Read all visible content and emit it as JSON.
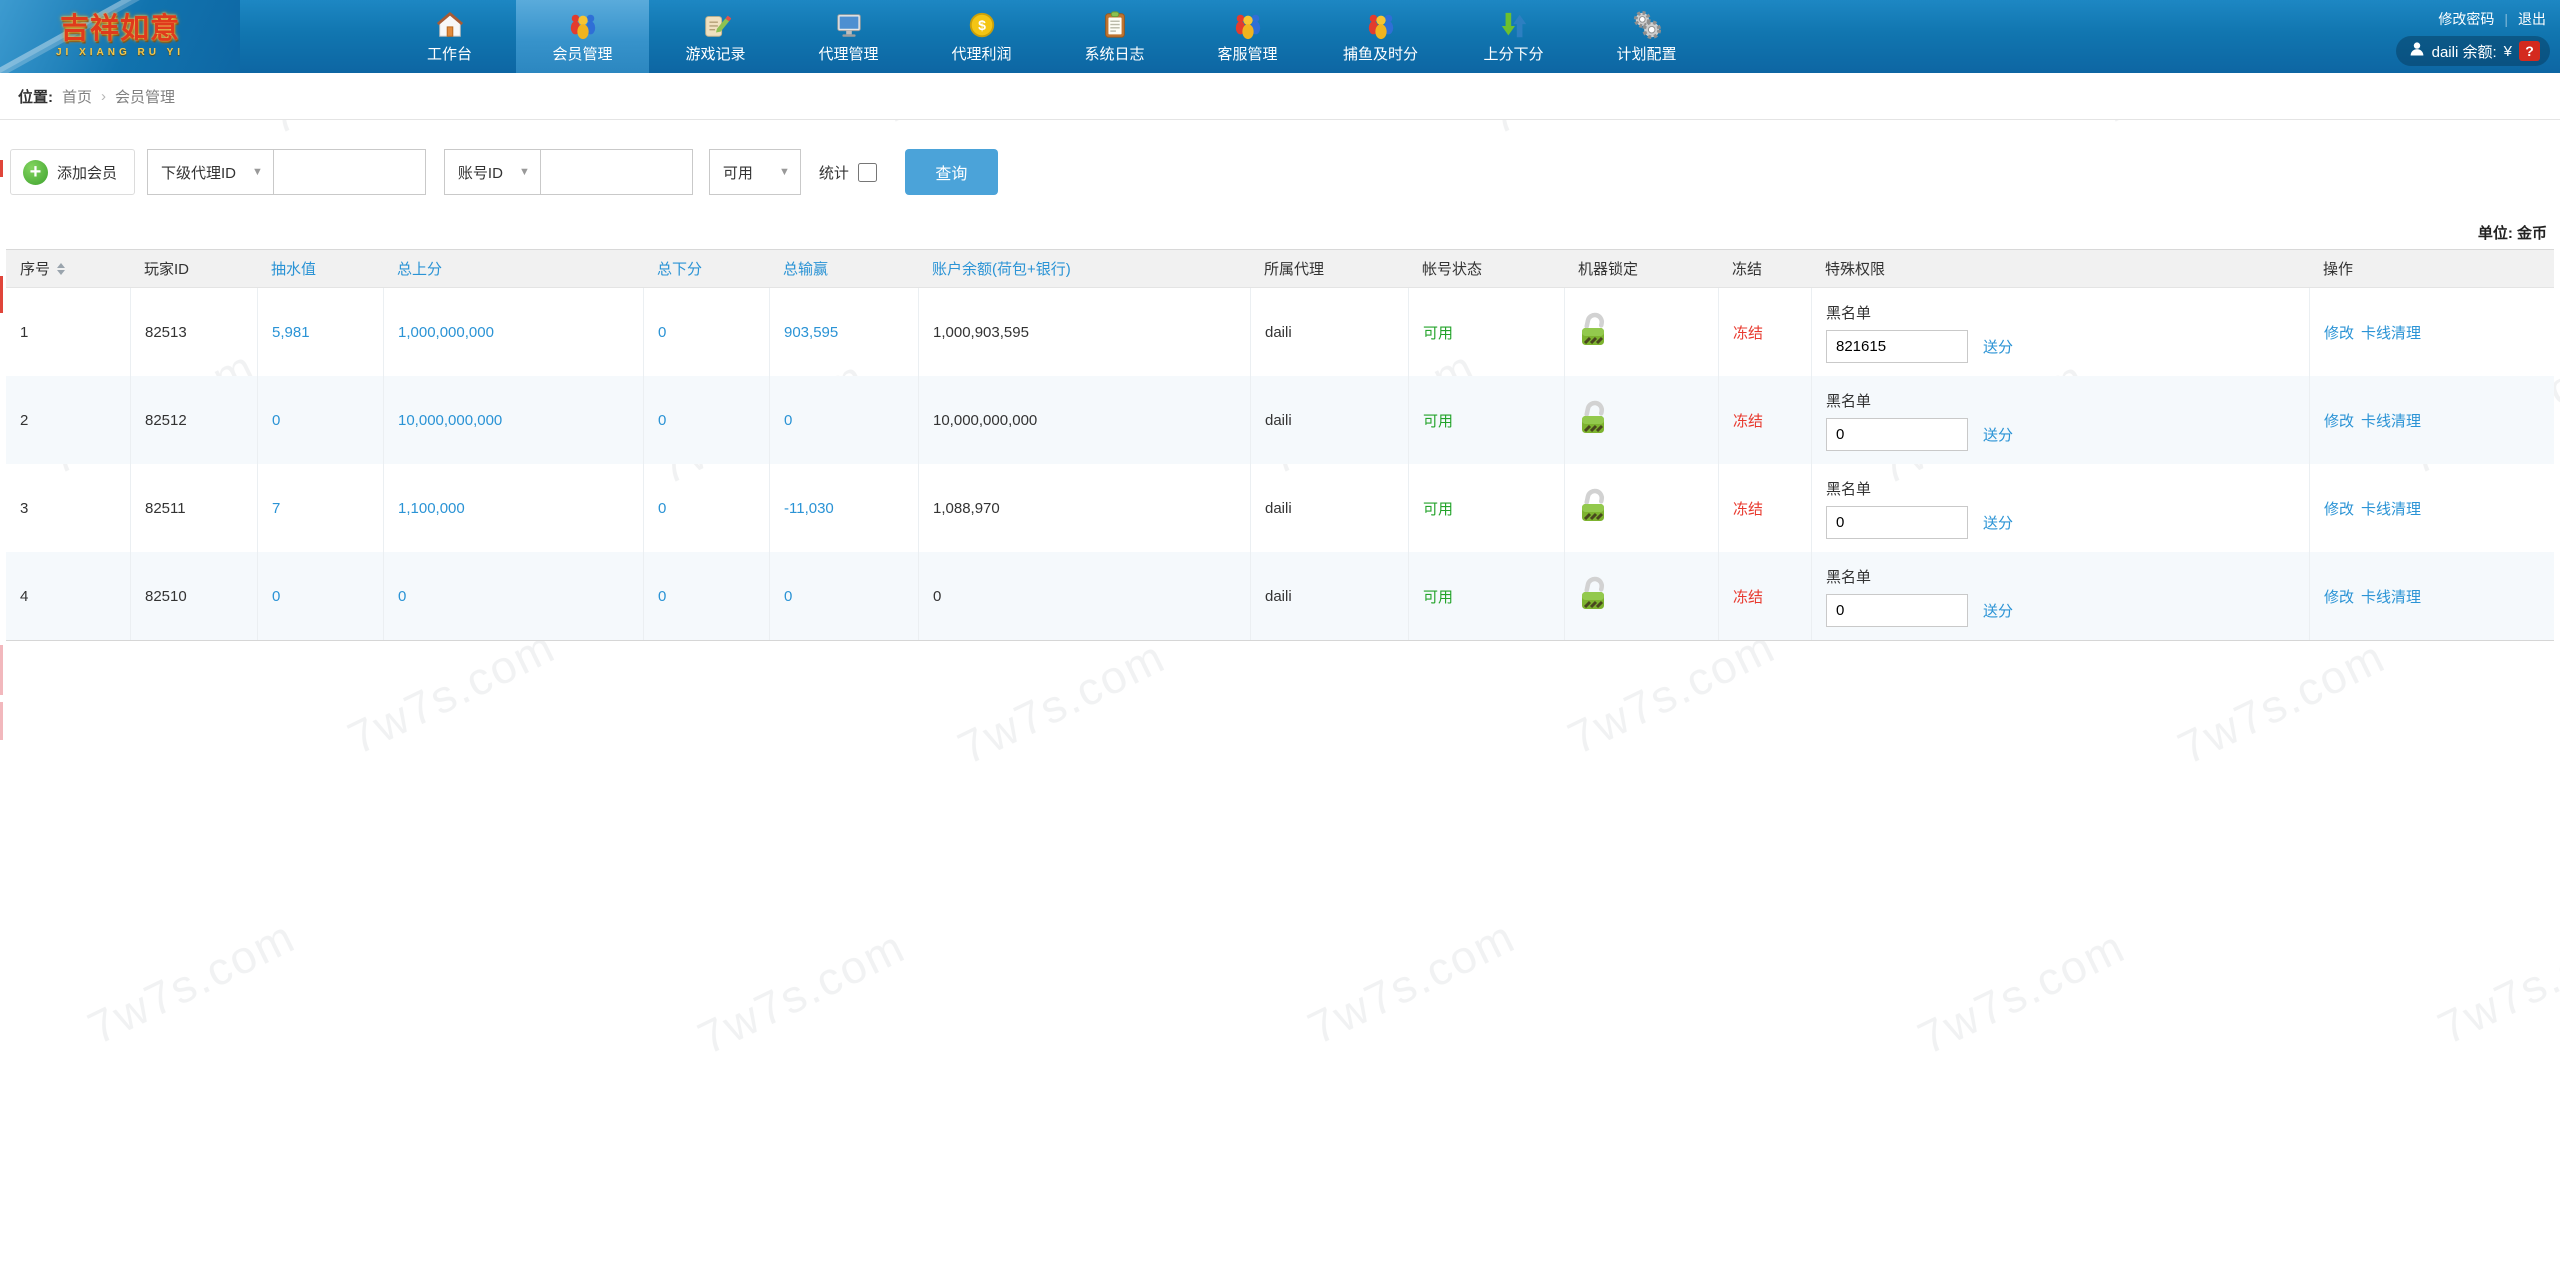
{
  "topbar": {
    "logo": {
      "title": "吉祥如意",
      "subtitle": "JI XIANG RU YI"
    },
    "menu": [
      {
        "label": "工作台",
        "icon": "home-icon",
        "active": false
      },
      {
        "label": "会员管理",
        "icon": "members-icon",
        "active": true
      },
      {
        "label": "游戏记录",
        "icon": "records-icon",
        "active": false
      },
      {
        "label": "代理管理",
        "icon": "monitor-icon",
        "active": false
      },
      {
        "label": "代理利润",
        "icon": "money-icon",
        "active": false
      },
      {
        "label": "系统日志",
        "icon": "clipboard-icon",
        "active": false
      },
      {
        "label": "客服管理",
        "icon": "support-icon",
        "active": false
      },
      {
        "label": "捕鱼及时分",
        "icon": "fishing-icon",
        "active": false
      },
      {
        "label": "上分下分",
        "icon": "updown-icon",
        "active": false
      },
      {
        "label": "计划配置",
        "icon": "gears-icon",
        "active": false
      }
    ],
    "links": {
      "change_password": "修改密码",
      "sep": "|",
      "logout": "退出"
    },
    "user": {
      "text": "daili 余额:",
      "currency": "¥",
      "badge": "?"
    }
  },
  "breadcrumb": {
    "label": "位置:",
    "home": "首页",
    "sep": "›",
    "current": "会员管理"
  },
  "toolbar": {
    "add_member": "添加会员",
    "filter_agent": {
      "selected": "下级代理ID"
    },
    "filter_account": {
      "selected": "账号ID"
    },
    "filter_status": {
      "selected": "可用"
    },
    "stats_label": "统计",
    "search_label": "查询"
  },
  "table": {
    "unit": "单位: 金币",
    "headers": [
      "序号",
      "玩家ID",
      "抽水值",
      "总上分",
      "总下分",
      "总输赢",
      "账户余额(荷包+银行)",
      "所属代理",
      "帐号状态",
      "机器锁定",
      "冻结",
      "特殊权限",
      "操作"
    ],
    "rows": [
      {
        "seq": "1",
        "player_id": "82513",
        "pump": "5,981",
        "total_up": "1,000,000,000",
        "total_down": "0",
        "win_loss": "903,595",
        "balance": "1,000,903,595",
        "agent": "daili",
        "status": "可用",
        "freeze": "冻结",
        "blacklist_label": "黑名单",
        "blacklist_value": "821615",
        "send_label": "送分",
        "op_edit": "修改",
        "op_clear": "卡线清理"
      },
      {
        "seq": "2",
        "player_id": "82512",
        "pump": "0",
        "total_up": "10,000,000,000",
        "total_down": "0",
        "win_loss": "0",
        "balance": "10,000,000,000",
        "agent": "daili",
        "status": "可用",
        "freeze": "冻结",
        "blacklist_label": "黑名单",
        "blacklist_value": "0",
        "send_label": "送分",
        "op_edit": "修改",
        "op_clear": "卡线清理"
      },
      {
        "seq": "3",
        "player_id": "82511",
        "pump": "7",
        "total_up": "1,100,000",
        "total_down": "0",
        "win_loss": "-11,030",
        "balance": "1,088,970",
        "agent": "daili",
        "status": "可用",
        "freeze": "冻结",
        "blacklist_label": "黑名单",
        "blacklist_value": "0",
        "send_label": "送分",
        "op_edit": "修改",
        "op_clear": "卡线清理"
      },
      {
        "seq": "4",
        "player_id": "82510",
        "pump": "0",
        "total_up": "0",
        "total_down": "0",
        "win_loss": "0",
        "balance": "0",
        "agent": "daili",
        "status": "可用",
        "freeze": "冻结",
        "blacklist_label": "黑名单",
        "blacklist_value": "0",
        "send_label": "送分",
        "op_edit": "修改",
        "op_clear": "卡线清理"
      }
    ]
  },
  "watermark": {
    "text": "7w7s.com"
  },
  "colors": {
    "nav_blue": "#1176b0",
    "active_blue": "#3793cb",
    "link_blue": "#2a93d5",
    "green": "#23a32a",
    "red": "#e8392e",
    "button_blue": "#4ba3d9"
  }
}
